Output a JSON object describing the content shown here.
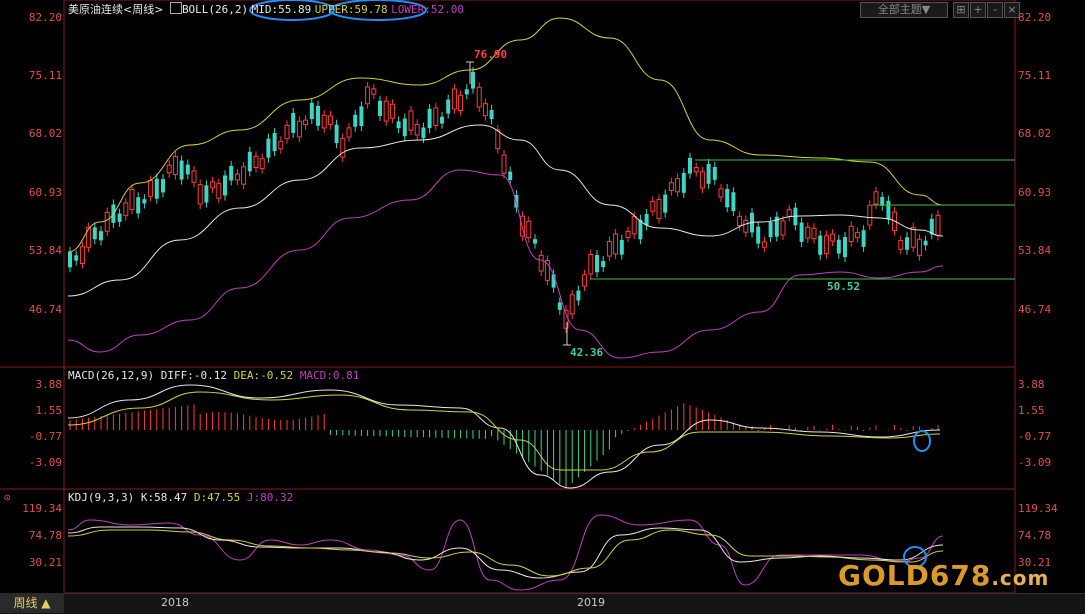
{
  "header": {
    "instrument": "美原油连续",
    "period_tag": "<周线>",
    "boll_label": "BOLL(26,2)",
    "mid": "MID:55.89",
    "upper": "UPPER:59.78",
    "lower": "LOWER:52.00",
    "theme_button": "全部主题▼",
    "buttons": [
      "⊞",
      "+",
      "-",
      "×"
    ]
  },
  "price_axis": [
    "82.20",
    "75.11",
    "68.02",
    "60.93",
    "53.84",
    "46.74"
  ],
  "annotations": {
    "high": "76.90",
    "low": "42.36",
    "support": "50.52"
  },
  "macd": {
    "label": "MACD(26,12,9)",
    "diff": "DIFF:-0.12",
    "dea": "DEA:-0.52",
    "macd": "MACD:0.81",
    "axis": [
      "3.88",
      "1.55",
      "-0.77",
      "-3.09"
    ]
  },
  "kdj": {
    "label": "KDJ(9,3,3)",
    "k": "K:58.47",
    "d": "D:47.55",
    "j": "J:80.32",
    "axis": [
      "119.34",
      "74.78",
      "30.21"
    ]
  },
  "bottom": {
    "period_button": "周线 ▲",
    "years": [
      "2018",
      "2019"
    ]
  },
  "watermark": {
    "main": "GOLD678",
    "dom": ".com"
  },
  "colors": {
    "up": "#ff3b3b",
    "down": "#3ad6c6",
    "mid": "#e8e8e8",
    "upper": "#d8d040",
    "lower": "#c040c0",
    "hline": "#40c040",
    "circle": "#1e90ff"
  }
}
